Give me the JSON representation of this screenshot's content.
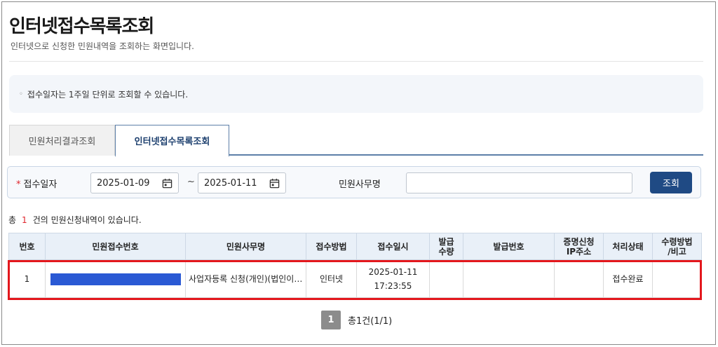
{
  "page": {
    "title": "인터넷접수목록조회",
    "description": "인터넷으로 신청한 민원내역을 조회하는 화면입니다."
  },
  "notice": {
    "bullet": "◦",
    "text": "접수일자는 1주일 단위로 조회할 수 있습니다."
  },
  "tabs": [
    {
      "label": "민원처리결과조회",
      "active": false
    },
    {
      "label": "인터넷접수목록조회",
      "active": true
    }
  ],
  "search": {
    "required_mark": "*",
    "date_label": "접수일자",
    "date_from": "2025-01-09",
    "date_to": "2025-01-11",
    "range_separator": "~",
    "office_label": "민원사무명",
    "office_value": "",
    "button_label": "조회"
  },
  "summary": {
    "prefix": "총",
    "count": "1",
    "suffix": "건의 민원신청내역이 있습니다."
  },
  "table": {
    "headers": [
      "번호",
      "민원접수번호",
      "민원사무명",
      "접수방법",
      "접수일시",
      "발급\n수량",
      "발급번호",
      "증명신청\nIP주소",
      "처리상태",
      "수령방법\n/비고"
    ],
    "rows": [
      {
        "no": "1",
        "receipt_no": "",
        "office_name": "사업자등록 신청(개인)(법인이 아닌 단체의 고유번호 신청)",
        "method": "인터넷",
        "received_date": "2025-01-11",
        "received_time": "17:23:55",
        "issue_qty": "",
        "issue_no": "",
        "ip": "",
        "status": "접수완료",
        "note": ""
      }
    ]
  },
  "pagination": {
    "current": "1",
    "total_label": "총1건(1/1)"
  },
  "colors": {
    "accent": "#1f4a84",
    "highlight": "#e3171d",
    "redaction": "#2a59d4"
  }
}
